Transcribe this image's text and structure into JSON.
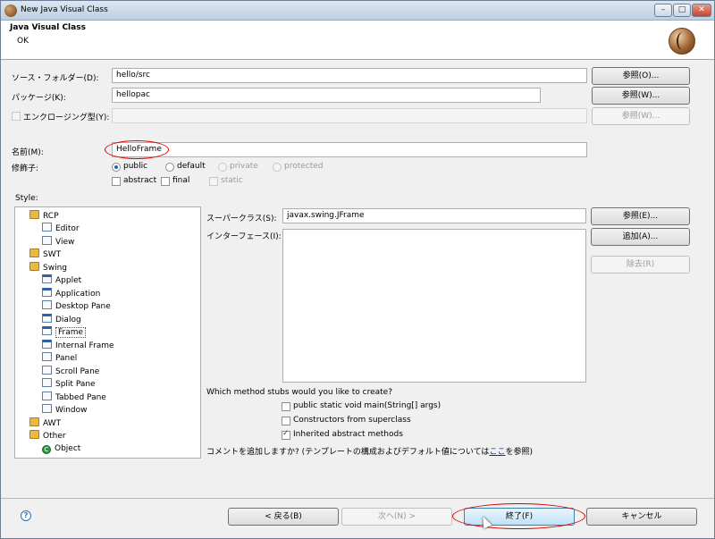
{
  "window": {
    "title": "New Java Visual Class",
    "minimize_icon": "minimize-icon",
    "maximize_icon": "maximize-icon",
    "close_icon": "close-icon"
  },
  "banner": {
    "heading": "Java Visual Class",
    "message": "OK",
    "logo_icon": "java-bean-icon"
  },
  "form": {
    "source_folder_label": "ソース・フォルダー(D):",
    "source_folder_value": "hello/src",
    "source_browse": "参照(O)...",
    "package_label": "パッケージ(K):",
    "package_value": "hellopac",
    "package_browse": "参照(W)...",
    "enclosing_label": "エンクロージング型(Y):",
    "enclosing_value": "",
    "enclosing_browse": "参照(W)...",
    "name_label": "名前(M):",
    "name_value": "HelloFrame",
    "modifiers_label": "修飾子:",
    "mod_public": "public",
    "mod_default": "default",
    "mod_private": "private",
    "mod_protected": "protected",
    "mod_abstract": "abstract",
    "mod_final": "final",
    "mod_static": "static",
    "style_label": "Style:",
    "superclass_label": "スーパークラス(S):",
    "superclass_value": "javax.swing.JFrame",
    "superclass_browse": "参照(E)...",
    "interfaces_label": "インターフェース(I):",
    "add_button": "追加(A)...",
    "remove_button": "除去(R)",
    "stubs_question": "Which method stubs would you like to create?",
    "stub_main": "public static void main(String[] args)",
    "stub_constructors": "Constructors from superclass",
    "stub_inherited": "Inherited abstract methods",
    "comment_prefix": "コメントを追加しますか? (テンプレートの構成およびデフォルト値については",
    "comment_link": "ここ",
    "comment_suffix": "を参照)"
  },
  "tree": {
    "rcp": "RCP",
    "editor": "Editor",
    "view": "View",
    "swt": "SWT",
    "swing": "Swing",
    "applet": "Applet",
    "application": "Application",
    "desktop_pane": "Desktop Pane",
    "dialog": "Dialog",
    "frame": "Frame",
    "internal_frame": "Internal Frame",
    "panel": "Panel",
    "scroll_pane": "Scroll Pane",
    "split_pane": "Split Pane",
    "tabbed_pane": "Tabbed Pane",
    "window": "Window",
    "awt": "AWT",
    "other": "Other",
    "object": "Object"
  },
  "footer": {
    "help_icon": "help-icon",
    "back": "< 戻る(B)",
    "next": "次へ(N) >",
    "finish": "終了(F)",
    "cancel": "キャンセル"
  },
  "colors": {
    "highlight_ellipse": "#d40000",
    "link": "#0033cc"
  }
}
